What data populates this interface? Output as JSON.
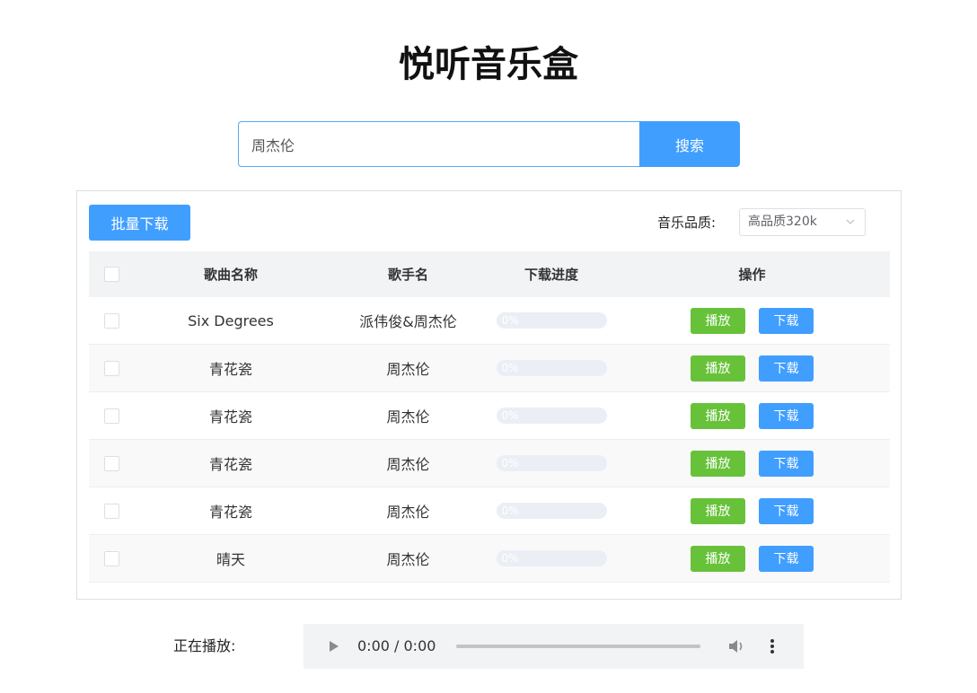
{
  "app": {
    "title": "悦听音乐盒"
  },
  "search": {
    "value": "周杰伦",
    "button_label": "搜索"
  },
  "toolbar": {
    "batch_download_label": "批量下载",
    "quality_label": "音乐品质:",
    "quality_selected": "高品质320k"
  },
  "table": {
    "headers": {
      "name": "歌曲名称",
      "artist": "歌手名",
      "progress": "下载进度",
      "ops": "操作"
    },
    "play_label": "播放",
    "download_label": "下载",
    "rows": [
      {
        "name": "Six Degrees",
        "artist": "派伟俊&周杰伦",
        "progress": 0,
        "progress_text": "0%"
      },
      {
        "name": "青花瓷",
        "artist": "周杰伦",
        "progress": 0,
        "progress_text": "0%"
      },
      {
        "name": "青花瓷",
        "artist": "周杰伦",
        "progress": 0,
        "progress_text": "0%"
      },
      {
        "name": "青花瓷",
        "artist": "周杰伦",
        "progress": 0,
        "progress_text": "0%"
      },
      {
        "name": "青花瓷",
        "artist": "周杰伦",
        "progress": 0,
        "progress_text": "0%"
      },
      {
        "name": "晴天",
        "artist": "周杰伦",
        "progress": 0,
        "progress_text": "0%"
      }
    ]
  },
  "player": {
    "label": "正在播放:",
    "time": "0:00 / 0:00"
  },
  "colors": {
    "primary": "#409eff",
    "success": "#67c23a"
  }
}
